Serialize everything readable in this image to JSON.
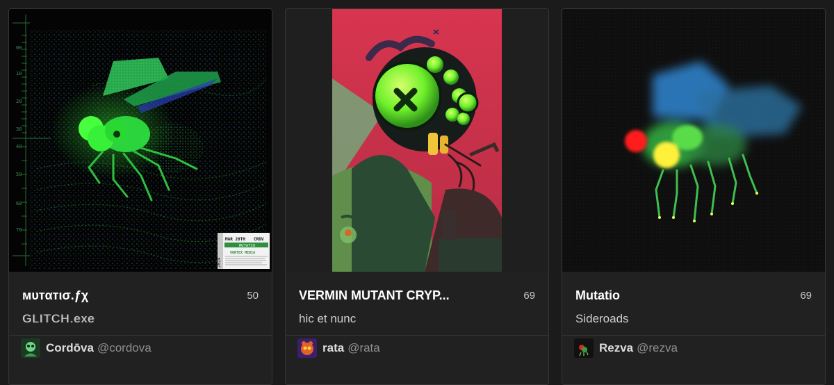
{
  "cards": [
    {
      "title": "мυтαтισ.ƒχ",
      "count": "50",
      "subtitle": "GLITCH.exe",
      "artist_name": "Cordōva",
      "artist_handle": "@cordova",
      "art_icon": "glitch-fly-artwork",
      "label_lines": [
        "MAR 20TH",
        "CRDV",
        "2024",
        "MUTATIO",
        "VORTEX MEDIA"
      ],
      "ruler_ticks": [
        "00",
        "10",
        "20",
        "30",
        "40",
        "50",
        "60",
        "70"
      ]
    },
    {
      "title": "VERMIN MUTANT CRYP...",
      "count": "69",
      "subtitle": "hic et nunc",
      "artist_name": "rata",
      "artist_handle": "@rata",
      "art_icon": "mutant-fly-creature-artwork"
    },
    {
      "title": "Mutatio",
      "count": "69",
      "subtitle": "Sideroads",
      "artist_name": "Rezva",
      "artist_handle": "@rezva",
      "art_icon": "blurred-fly-artwork"
    }
  ],
  "colors": {
    "page_bg": "#1b1b1b",
    "card_bg": "#212121",
    "card_border": "#363636",
    "neon_green": "#37ff37",
    "art2_bg": "#c8344a"
  }
}
